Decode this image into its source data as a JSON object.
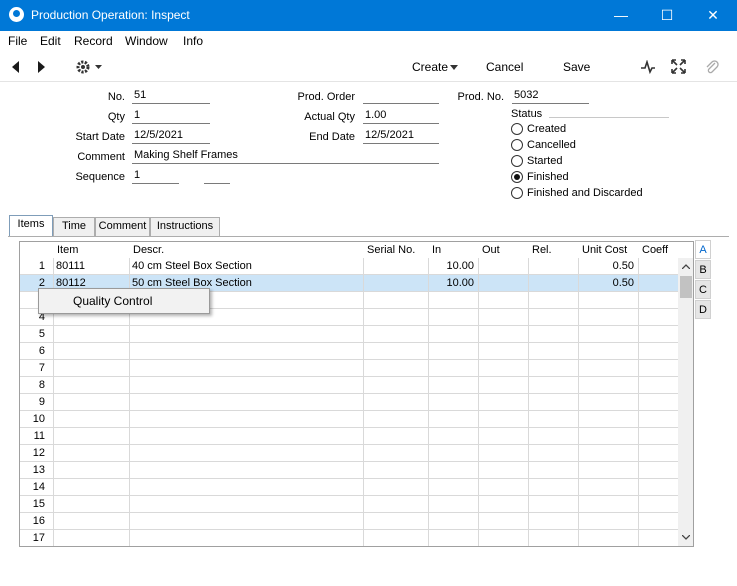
{
  "window": {
    "title": "Production Operation: Inspect",
    "minimize": "—",
    "maximize": "☐",
    "close": "✕"
  },
  "menu": [
    "File",
    "Edit",
    "Record",
    "Window",
    "Info"
  ],
  "toolbar": {
    "create": "Create",
    "cancel": "Cancel",
    "save": "Save"
  },
  "form": {
    "no_label": "No.",
    "no": "51",
    "qty_label": "Qty",
    "qty": "1",
    "start_label": "Start Date",
    "start": "12/5/2021",
    "comment_label": "Comment",
    "comment": "Making Shelf Frames",
    "seq_label": "Sequence",
    "seq": "1",
    "seq2": "",
    "prodorder_label": "Prod. Order",
    "prodorder": "",
    "actualqty_label": "Actual Qty",
    "actualqty": "1.00",
    "enddate_label": "End Date",
    "enddate": "12/5/2021",
    "prodno_label": "Prod. No.",
    "prodno": "5032",
    "status_label": "Status",
    "status_options": [
      "Created",
      "Cancelled",
      "Started",
      "Finished",
      "Finished and Discarded"
    ],
    "status_selected": "Finished"
  },
  "tabs": [
    "Items",
    "Time",
    "Comment",
    "Instructions"
  ],
  "active_tab": "Items",
  "grid": {
    "columns": [
      "Item",
      "Descr.",
      "Serial No.",
      "In",
      "Out",
      "Rel.",
      "Unit Cost",
      "Coeff"
    ],
    "rows": [
      {
        "n": "1",
        "item": "80111",
        "descr": "40 cm Steel Box Section",
        "serial": "",
        "in": "10.00",
        "out": "",
        "rel": "",
        "cost": "0.50",
        "coeff": ""
      },
      {
        "n": "2",
        "item": "80112",
        "descr": "50 cm Steel Box Section",
        "serial": "",
        "in": "10.00",
        "out": "",
        "rel": "",
        "cost": "0.50",
        "coeff": ""
      },
      {
        "n": "",
        "item": "",
        "descr": "",
        "serial": "",
        "in": "",
        "out": "",
        "rel": "",
        "cost": "",
        "coeff": ""
      },
      {
        "n": "4"
      },
      {
        "n": "5"
      },
      {
        "n": "6"
      },
      {
        "n": "7"
      },
      {
        "n": "8"
      },
      {
        "n": "9"
      },
      {
        "n": "10"
      },
      {
        "n": "11"
      },
      {
        "n": "12"
      },
      {
        "n": "13"
      },
      {
        "n": "14"
      },
      {
        "n": "15"
      },
      {
        "n": "16"
      },
      {
        "n": "17"
      }
    ],
    "side_tabs": [
      "A",
      "B",
      "C",
      "D"
    ],
    "active_side_tab": "A"
  },
  "context_menu": {
    "item": "Quality Control"
  }
}
